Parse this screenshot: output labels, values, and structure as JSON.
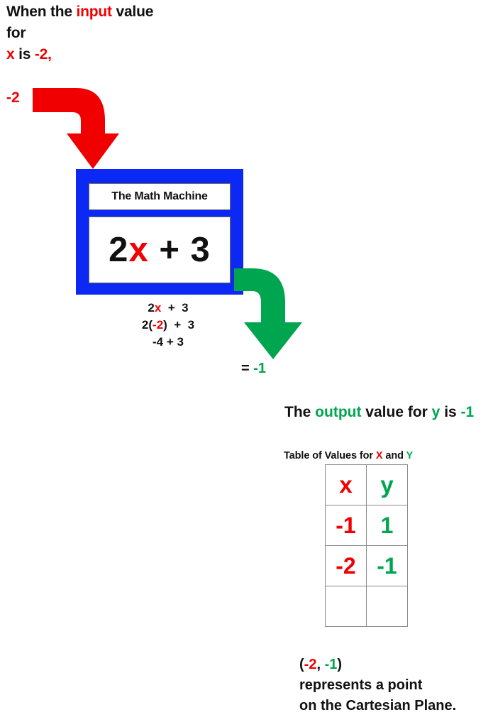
{
  "colors": {
    "red": "#F00000",
    "green": "#00A550",
    "blue": "#0B28F5",
    "black": "#111111",
    "white": "#FFFFFF",
    "table_border": "#8A8A8A"
  },
  "intro": {
    "line1_a": "When the ",
    "line1_b": "input",
    "line1_c": " value",
    "line2": "for",
    "line3_a": "x",
    "line3_b": " is ",
    "line3_c": "-2,"
  },
  "input": {
    "value_label": "-2",
    "arrow_name": "input-arrow",
    "arrow_color": "#F00000"
  },
  "machine": {
    "title": "The Math Machine",
    "formula_a": "2",
    "formula_b": "x",
    "formula_c": " + 3"
  },
  "work": {
    "step1_a": "2",
    "step1_b": "x",
    "step1_c": "  +  3",
    "step2_a": "2(",
    "step2_b": "-2",
    "step2_c": ")  +  3",
    "step3": "-4 + 3"
  },
  "output": {
    "arrow_name": "output-arrow",
    "arrow_color": "#00A550",
    "result_eq": "= ",
    "result_value": "-1",
    "statement_a": "The ",
    "statement_b": "output",
    "statement_c": " value for ",
    "statement_d": "y",
    "statement_e": " is ",
    "statement_f": "-1"
  },
  "table": {
    "caption_a": "Table of Values for ",
    "caption_b": "X",
    "caption_c": " and ",
    "caption_d": "Y",
    "headers": [
      "x",
      "y"
    ],
    "rows": [
      [
        "-1",
        "1"
      ],
      [
        "-2",
        "-1"
      ],
      [
        "",
        ""
      ]
    ]
  },
  "closing": {
    "line1_a": "(",
    "line1_b": "-2",
    "line1_c": ", ",
    "line1_d": "-1",
    "line1_e": ")",
    "line2": "represents a point",
    "line3": "on the Cartesian Plane."
  }
}
